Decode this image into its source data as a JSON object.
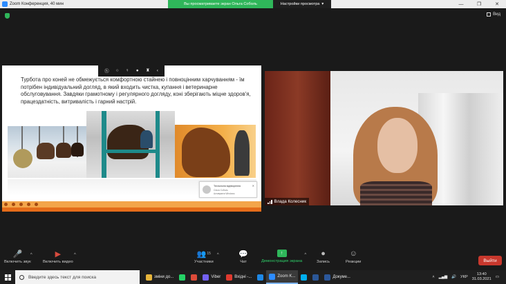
{
  "window": {
    "title": "Zoom Конференция, 40 мин",
    "controls": [
      "—",
      "❐",
      "✕"
    ]
  },
  "share_banner": {
    "status": "Вы просматриваете экран Ольга Соболь",
    "view_options": "Настройки просмотра",
    "view_caret": "▾"
  },
  "view_button": {
    "label": "Вид"
  },
  "slide": {
    "text": "Турбота про коней не обмежується комфортною стайнею і повноцінним харчуванням - їм потрібен індивідуальний догляд, в який входить чистка, купання і ветеринарне обслуговування. Завдяки грамотному і регулярного догляду, коні зберігають міцне здоров'я, працездатність, витривалість і гарний настрій.",
    "notice": {
      "line1": "Технологія відтворення",
      "line2": "Ольга Соболь",
      "line3": "Активувати Windows",
      "icon": "✕"
    }
  },
  "slide_toolbar": {
    "items": [
      {
        "icon": "hp-logo",
        "glyph": "ⓗ"
      },
      {
        "icon": "pen-icon",
        "glyph": "○"
      },
      {
        "icon": "microphone-icon",
        "glyph": "♀"
      },
      {
        "icon": "record-icon",
        "glyph": "●"
      },
      {
        "icon": "menu-icon",
        "glyph": "♜"
      },
      {
        "icon": "chevron-left-icon",
        "glyph": "‹"
      }
    ]
  },
  "video": {
    "participant_name": "Влада Колесник"
  },
  "toolbar": {
    "mute": {
      "label": "Включить звук",
      "glyph": "🎤"
    },
    "video": {
      "label": "Включить видео",
      "glyph": "▶"
    },
    "participants": {
      "label": "Участники",
      "count": "15",
      "glyph": "👥"
    },
    "chat": {
      "label": "Чат",
      "glyph": "💬"
    },
    "share": {
      "label": "Демонстрация экрана",
      "glyph": "↑"
    },
    "record": {
      "label": "Запись",
      "glyph": "●"
    },
    "reactions": {
      "label": "Реакции",
      "glyph": "☺"
    },
    "leave": {
      "label": "Выйти"
    },
    "caret": "^"
  },
  "taskbar": {
    "search_placeholder": "Введите здесь текст для поиска",
    "tasks": [
      {
        "label": "зміни до...",
        "color": "#e7b53b",
        "active": false
      },
      {
        "label": "",
        "color": "#25d366",
        "active": false
      },
      {
        "label": "",
        "color": "#dd4b39",
        "active": false
      },
      {
        "label": "Viber",
        "color": "#7360f2",
        "active": false
      },
      {
        "label": "Вхідні -...",
        "color": "#e03a2f",
        "active": false
      },
      {
        "label": "",
        "color": "#1e88e5",
        "active": false
      },
      {
        "label": "Zoom K...",
        "color": "#2d8cff",
        "active": true
      },
      {
        "label": "",
        "color": "#00aff0",
        "active": false
      },
      {
        "label": "",
        "color": "#2b5797",
        "active": false
      },
      {
        "label": "Докуме...",
        "color": "#2b579a",
        "active": false
      }
    ],
    "language": "УКР",
    "time": "13:40",
    "date": "31.03.2021"
  }
}
